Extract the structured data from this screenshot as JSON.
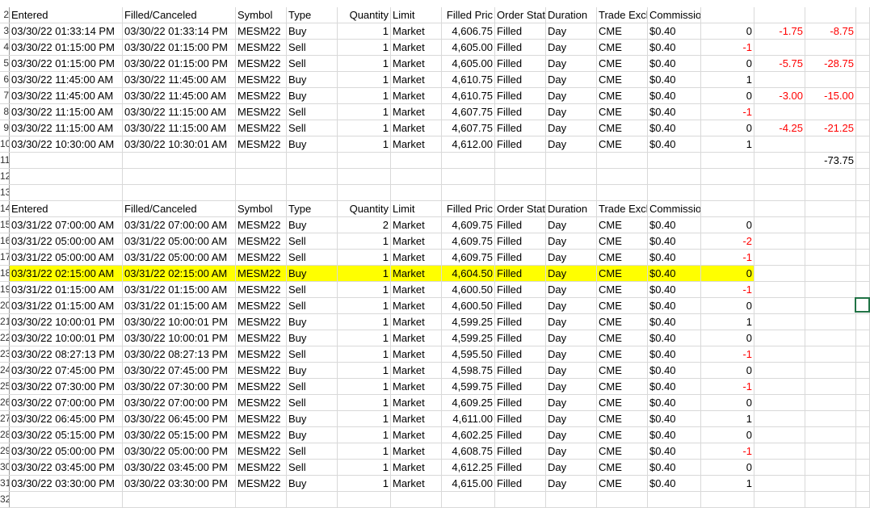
{
  "row_numbers": [
    "2",
    "3",
    "4",
    "5",
    "6",
    "7",
    "8",
    "9",
    "10",
    "11",
    "12",
    "13",
    "14",
    "15",
    "16",
    "17",
    "18",
    "19",
    "20",
    "21",
    "22",
    "23",
    "24",
    "25",
    "26",
    "27",
    "28",
    "29",
    "30",
    "31",
    "32"
  ],
  "headers": {
    "entered": "Entered",
    "filled": "Filled/Canceled",
    "symbol": "Symbol",
    "type": "Type",
    "qty": "Quantity",
    "limit": "Limit",
    "fprice": "Filled Pric",
    "status": "Order Stat",
    "duration": "Duration",
    "exch": "Trade Excl",
    "comm": "Commission"
  },
  "table1": [
    {
      "entered": "03/30/22 01:33:14 PM",
      "filled": "03/30/22 01:33:14 PM",
      "symbol": "MESM22",
      "type": "Buy",
      "qty": "1",
      "limit": "Market",
      "fprice": "4,606.75",
      "status": "Filled",
      "duration": "Day",
      "exch": "CME",
      "comm": "$0.40",
      "pos": "0",
      "pts": "-1.75",
      "usd": "-8.75"
    },
    {
      "entered": "03/30/22 01:15:00 PM",
      "filled": "03/30/22 01:15:00 PM",
      "symbol": "MESM22",
      "type": "Sell",
      "qty": "1",
      "limit": "Market",
      "fprice": "4,605.00",
      "status": "Filled",
      "duration": "Day",
      "exch": "CME",
      "comm": "$0.40",
      "pos": "-1",
      "pts": "",
      "usd": ""
    },
    {
      "entered": "03/30/22 01:15:00 PM",
      "filled": "03/30/22 01:15:00 PM",
      "symbol": "MESM22",
      "type": "Sell",
      "qty": "1",
      "limit": "Market",
      "fprice": "4,605.00",
      "status": "Filled",
      "duration": "Day",
      "exch": "CME",
      "comm": "$0.40",
      "pos": "0",
      "pts": "-5.75",
      "usd": "-28.75"
    },
    {
      "entered": "03/30/22 11:45:00 AM",
      "filled": "03/30/22 11:45:00 AM",
      "symbol": "MESM22",
      "type": "Buy",
      "qty": "1",
      "limit": "Market",
      "fprice": "4,610.75",
      "status": "Filled",
      "duration": "Day",
      "exch": "CME",
      "comm": "$0.40",
      "pos": "1",
      "pts": "",
      "usd": ""
    },
    {
      "entered": "03/30/22 11:45:00 AM",
      "filled": "03/30/22 11:45:00 AM",
      "symbol": "MESM22",
      "type": "Buy",
      "qty": "1",
      "limit": "Market",
      "fprice": "4,610.75",
      "status": "Filled",
      "duration": "Day",
      "exch": "CME",
      "comm": "$0.40",
      "pos": "0",
      "pts": "-3.00",
      "usd": "-15.00"
    },
    {
      "entered": "03/30/22 11:15:00 AM",
      "filled": "03/30/22 11:15:00 AM",
      "symbol": "MESM22",
      "type": "Sell",
      "qty": "1",
      "limit": "Market",
      "fprice": "4,607.75",
      "status": "Filled",
      "duration": "Day",
      "exch": "CME",
      "comm": "$0.40",
      "pos": "-1",
      "pts": "",
      "usd": ""
    },
    {
      "entered": "03/30/22 11:15:00 AM",
      "filled": "03/30/22 11:15:00 AM",
      "symbol": "MESM22",
      "type": "Sell",
      "qty": "1",
      "limit": "Market",
      "fprice": "4,607.75",
      "status": "Filled",
      "duration": "Day",
      "exch": "CME",
      "comm": "$0.40",
      "pos": "0",
      "pts": "-4.25",
      "usd": "-21.25"
    },
    {
      "entered": "03/30/22 10:30:00 AM",
      "filled": "03/30/22 10:30:01 AM",
      "symbol": "MESM22",
      "type": "Buy",
      "qty": "1",
      "limit": "Market",
      "fprice": "4,612.00",
      "status": "Filled",
      "duration": "Day",
      "exch": "CME",
      "comm": "$0.40",
      "pos": "1",
      "pts": "",
      "usd": ""
    }
  ],
  "total": "-73.75",
  "table2": [
    {
      "entered": "03/31/22 07:00:00 AM",
      "filled": "03/31/22 07:00:00 AM",
      "symbol": "MESM22",
      "type": "Buy",
      "qty": "2",
      "limit": "Market",
      "fprice": "4,609.75",
      "status": "Filled",
      "duration": "Day",
      "exch": "CME",
      "comm": "$0.40",
      "pos": "0",
      "highlight": false
    },
    {
      "entered": "03/31/22 05:00:00 AM",
      "filled": "03/31/22 05:00:00 AM",
      "symbol": "MESM22",
      "type": "Sell",
      "qty": "1",
      "limit": "Market",
      "fprice": "4,609.75",
      "status": "Filled",
      "duration": "Day",
      "exch": "CME",
      "comm": "$0.40",
      "pos": "-2",
      "highlight": false
    },
    {
      "entered": "03/31/22 05:00:00 AM",
      "filled": "03/31/22 05:00:00 AM",
      "symbol": "MESM22",
      "type": "Sell",
      "qty": "1",
      "limit": "Market",
      "fprice": "4,609.75",
      "status": "Filled",
      "duration": "Day",
      "exch": "CME",
      "comm": "$0.40",
      "pos": "-1",
      "highlight": false
    },
    {
      "entered": "03/31/22 02:15:00 AM",
      "filled": "03/31/22 02:15:00 AM",
      "symbol": "MESM22",
      "type": "Buy",
      "qty": "1",
      "limit": "Market",
      "fprice": "4,604.50",
      "status": "Filled",
      "duration": "Day",
      "exch": "CME",
      "comm": "$0.40",
      "pos": "0",
      "highlight": true
    },
    {
      "entered": "03/31/22 01:15:00 AM",
      "filled": "03/31/22 01:15:00 AM",
      "symbol": "MESM22",
      "type": "Sell",
      "qty": "1",
      "limit": "Market",
      "fprice": "4,600.50",
      "status": "Filled",
      "duration": "Day",
      "exch": "CME",
      "comm": "$0.40",
      "pos": "-1",
      "highlight": false
    },
    {
      "entered": "03/31/22 01:15:00 AM",
      "filled": "03/31/22 01:15:00 AM",
      "symbol": "MESM22",
      "type": "Sell",
      "qty": "1",
      "limit": "Market",
      "fprice": "4,600.50",
      "status": "Filled",
      "duration": "Day",
      "exch": "CME",
      "comm": "$0.40",
      "pos": "0",
      "highlight": false
    },
    {
      "entered": "03/30/22 10:00:01 PM",
      "filled": "03/30/22 10:00:01 PM",
      "symbol": "MESM22",
      "type": "Buy",
      "qty": "1",
      "limit": "Market",
      "fprice": "4,599.25",
      "status": "Filled",
      "duration": "Day",
      "exch": "CME",
      "comm": "$0.40",
      "pos": "1",
      "highlight": false
    },
    {
      "entered": "03/30/22 10:00:01 PM",
      "filled": "03/30/22 10:00:01 PM",
      "symbol": "MESM22",
      "type": "Buy",
      "qty": "1",
      "limit": "Market",
      "fprice": "4,599.25",
      "status": "Filled",
      "duration": "Day",
      "exch": "CME",
      "comm": "$0.40",
      "pos": "0",
      "highlight": false
    },
    {
      "entered": "03/30/22 08:27:13 PM",
      "filled": "03/30/22 08:27:13 PM",
      "symbol": "MESM22",
      "type": "Sell",
      "qty": "1",
      "limit": "Market",
      "fprice": "4,595.50",
      "status": "Filled",
      "duration": "Day",
      "exch": "CME",
      "comm": "$0.40",
      "pos": "-1",
      "highlight": false
    },
    {
      "entered": "03/30/22 07:45:00 PM",
      "filled": "03/30/22 07:45:00 PM",
      "symbol": "MESM22",
      "type": "Buy",
      "qty": "1",
      "limit": "Market",
      "fprice": "4,598.75",
      "status": "Filled",
      "duration": "Day",
      "exch": "CME",
      "comm": "$0.40",
      "pos": "0",
      "highlight": false
    },
    {
      "entered": "03/30/22 07:30:00 PM",
      "filled": "03/30/22 07:30:00 PM",
      "symbol": "MESM22",
      "type": "Sell",
      "qty": "1",
      "limit": "Market",
      "fprice": "4,599.75",
      "status": "Filled",
      "duration": "Day",
      "exch": "CME",
      "comm": "$0.40",
      "pos": "-1",
      "highlight": false
    },
    {
      "entered": "03/30/22 07:00:00 PM",
      "filled": "03/30/22 07:00:00 PM",
      "symbol": "MESM22",
      "type": "Sell",
      "qty": "1",
      "limit": "Market",
      "fprice": "4,609.25",
      "status": "Filled",
      "duration": "Day",
      "exch": "CME",
      "comm": "$0.40",
      "pos": "0",
      "highlight": false
    },
    {
      "entered": "03/30/22 06:45:00 PM",
      "filled": "03/30/22 06:45:00 PM",
      "symbol": "MESM22",
      "type": "Buy",
      "qty": "1",
      "limit": "Market",
      "fprice": "4,611.00",
      "status": "Filled",
      "duration": "Day",
      "exch": "CME",
      "comm": "$0.40",
      "pos": "1",
      "highlight": false
    },
    {
      "entered": "03/30/22 05:15:00 PM",
      "filled": "03/30/22 05:15:00 PM",
      "symbol": "MESM22",
      "type": "Buy",
      "qty": "1",
      "limit": "Market",
      "fprice": "4,602.25",
      "status": "Filled",
      "duration": "Day",
      "exch": "CME",
      "comm": "$0.40",
      "pos": "0",
      "highlight": false
    },
    {
      "entered": "03/30/22 05:00:00 PM",
      "filled": "03/30/22 05:00:00 PM",
      "symbol": "MESM22",
      "type": "Sell",
      "qty": "1",
      "limit": "Market",
      "fprice": "4,608.75",
      "status": "Filled",
      "duration": "Day",
      "exch": "CME",
      "comm": "$0.40",
      "pos": "-1",
      "highlight": false
    },
    {
      "entered": "03/30/22 03:45:00 PM",
      "filled": "03/30/22 03:45:00 PM",
      "symbol": "MESM22",
      "type": "Sell",
      "qty": "1",
      "limit": "Market",
      "fprice": "4,612.25",
      "status": "Filled",
      "duration": "Day",
      "exch": "CME",
      "comm": "$0.40",
      "pos": "0",
      "highlight": false
    },
    {
      "entered": "03/30/22 03:30:00 PM",
      "filled": "03/30/22 03:30:00 PM",
      "symbol": "MESM22",
      "type": "Buy",
      "qty": "1",
      "limit": "Market",
      "fprice": "4,615.00",
      "status": "Filled",
      "duration": "Day",
      "exch": "CME",
      "comm": "$0.40",
      "pos": "1",
      "highlight": false
    }
  ],
  "colors": {
    "highlight": "#ffff00",
    "negative": "#ff0000",
    "selection": "#217346",
    "gridline": "#d9d9d9"
  }
}
